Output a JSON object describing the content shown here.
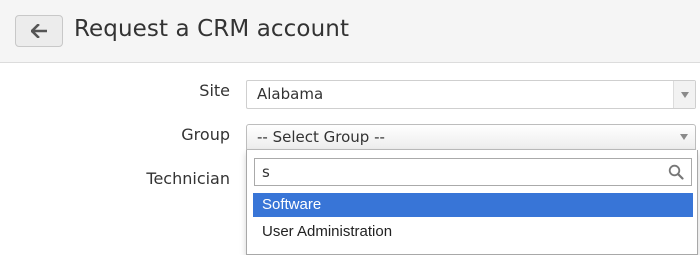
{
  "header": {
    "title": "Request a CRM account",
    "back_icon": "arrow-left-icon"
  },
  "form": {
    "site": {
      "label": "Site",
      "value": "Alabama"
    },
    "group": {
      "label": "Group",
      "value": "-- Select Group --"
    },
    "technician": {
      "label": "Technician"
    }
  },
  "dropdown": {
    "search_value": "s",
    "search_icon": "magnifier-icon",
    "options": [
      {
        "label": "Software",
        "highlighted": true
      },
      {
        "label": "User Administration",
        "highlighted": false
      }
    ]
  },
  "colors": {
    "highlight": "#3875d7",
    "header_bg": "#f5f5f5"
  }
}
